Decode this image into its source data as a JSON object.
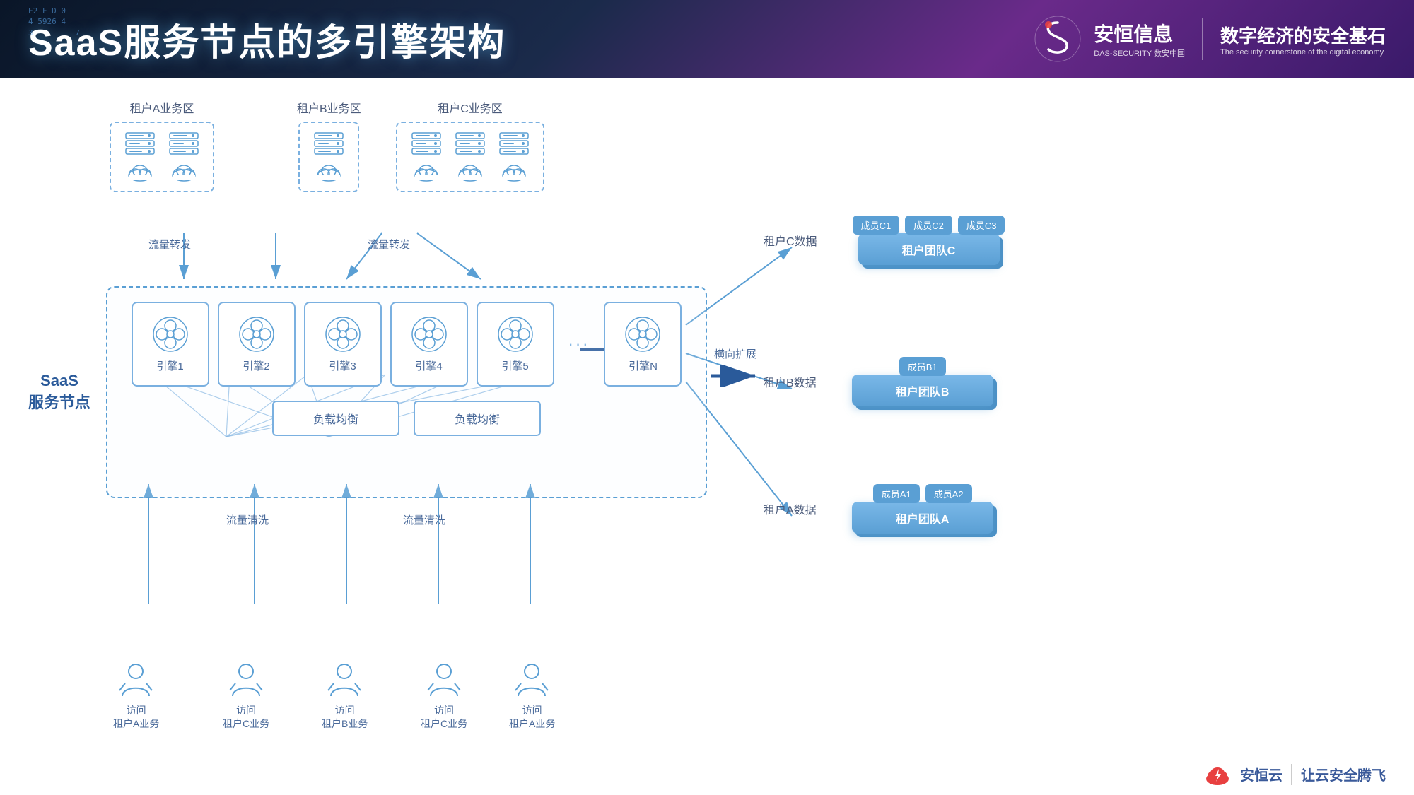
{
  "header": {
    "title": "SaaS服务节点的多引擎架构",
    "matrix_text": "E2 F D 0\n4 5926 4\n3 7",
    "logo": {
      "company_cn": "安恒信息",
      "company_sub": "DAS-SECURITY 数安中国",
      "tagline_cn": "数字经济的安全基石",
      "tagline_en": "The security cornerstone of the digital economy"
    }
  },
  "tenants": {
    "zone_a_label": "租户A业务区",
    "zone_b_label": "租户B业务区",
    "zone_c_label": "租户C业务区"
  },
  "saas_node": {
    "label_line1": "SaaS",
    "label_line2": "服务节点",
    "engines": [
      {
        "label": "引擎1"
      },
      {
        "label": "引擎2"
      },
      {
        "label": "引擎3"
      },
      {
        "label": "引擎4"
      },
      {
        "label": "引擎5"
      },
      {
        "label": "引擎N"
      }
    ],
    "load_balance_1": "负载均衡",
    "load_balance_2": "负载均衡",
    "expand_label": "横向扩展"
  },
  "flow_labels": {
    "forward_1": "流量转发",
    "forward_2": "流量转发",
    "clean_1": "流量清洗",
    "clean_2": "流量清洗"
  },
  "tenant_data": {
    "c_label": "租户C数据",
    "b_label": "租户B数据",
    "a_label": "租户A数据",
    "team_c": {
      "members": [
        "成员C1",
        "成员C2",
        "成员C3"
      ],
      "team_name": "租户团队C"
    },
    "team_b": {
      "members": [
        "成员B1"
      ],
      "team_name": "租户团队B"
    },
    "team_a": {
      "members": [
        "成员A1",
        "成员A2"
      ],
      "team_name": "租户团队A"
    }
  },
  "users": [
    {
      "label_bottom": "访问\n租户A业务"
    },
    {
      "label_top": "流量清洗",
      "label_bottom": "访问\n租户C业务"
    },
    {
      "label_bottom": "访问\n租户B业务"
    },
    {
      "label_top": "流量清洗",
      "label_bottom": "访问\n租户C业务"
    },
    {
      "label_bottom": "访问\n租户A业务"
    }
  ],
  "footer": {
    "logo_text": "安恒云",
    "divider": "|",
    "tagline": "让云安全腾飞"
  },
  "colors": {
    "accent_blue": "#5a9fd4",
    "light_blue": "#7ab0e0",
    "dark_blue": "#2a5a9a",
    "border_dashed": "#7ab0e0",
    "text_gray": "#4a6a9a"
  }
}
